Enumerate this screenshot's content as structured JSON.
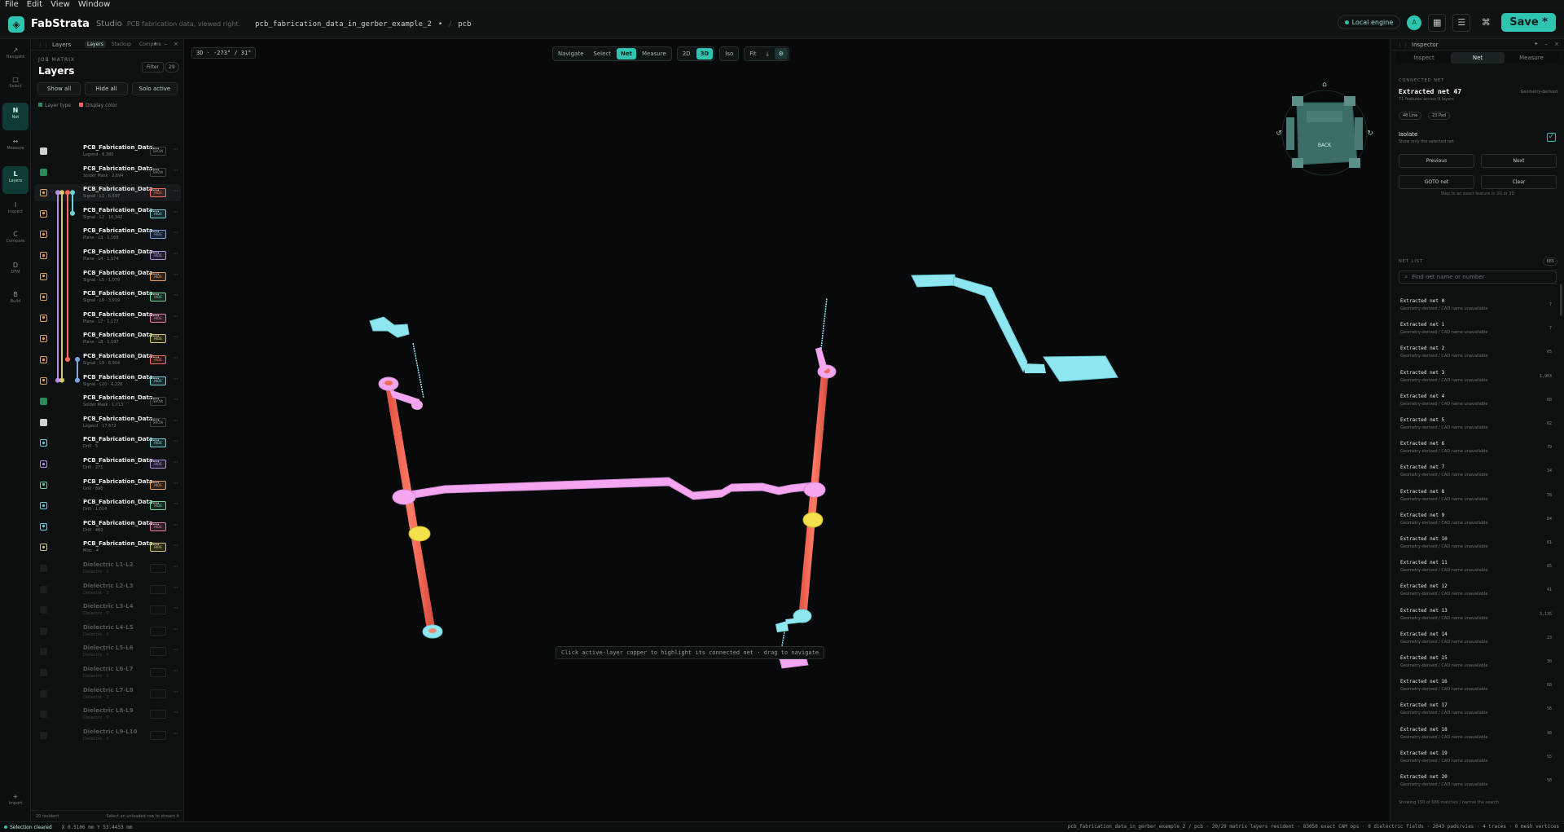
{
  "menu": [
    "File",
    "Edit",
    "View",
    "Window"
  ],
  "header": {
    "app_name": "FabStrata",
    "app_edition": "Studio",
    "app_hint": "PCB fabrication data, viewed right.",
    "project": "pcb_fabrication_data_in_gerber_example_2",
    "project_marker": "•",
    "breadcrumb_sep": "/",
    "breadcrumb_leaf": "pcb",
    "engine": "Local engine",
    "avatar": "A",
    "save": "Save *"
  },
  "rail": [
    {
      "glyph": "↗",
      "label": "Navigate"
    },
    {
      "glyph": "□",
      "label": "Select"
    },
    {
      "glyph": "N",
      "label": "Net",
      "active": true
    },
    {
      "glyph": "↔",
      "label": "Measure"
    },
    {
      "glyph": "L",
      "label": "Layers",
      "active": true
    },
    {
      "glyph": "I",
      "label": "Inspect"
    },
    {
      "glyph": "C",
      "label": "Compare"
    },
    {
      "glyph": "D",
      "label": "DFM"
    },
    {
      "glyph": "B",
      "label": "Build"
    },
    {
      "glyph": "+",
      "label": "Import"
    }
  ],
  "layers_panel": {
    "title": "Layers",
    "tabs": [
      "Layers",
      "Stackup",
      "Compare"
    ],
    "matrix_label": "JOB MATRIX",
    "heading": "Layers",
    "filter": "Filter",
    "count": "29",
    "show_all": "Show all",
    "hide_all": "Hide all",
    "solo_active": "Solo active",
    "legend_type": "Layer type",
    "legend_color": "Display color",
    "footer_left": "20 resident",
    "footer_right": "Select an unloaded row to stream it",
    "rows": [
      {
        "name": "PCB_Fabrication_Data...",
        "sub": "Legend · 8,380",
        "tag": "SHOW",
        "color": "#d0d3d4",
        "style": "solid"
      },
      {
        "name": "PCB_Fabrication_Data...",
        "sub": "Solder Mask · 2,694",
        "tag": "SHOW",
        "color": "#2e8a5a",
        "style": "solid"
      },
      {
        "name": "PCB_Fabrication_Data...",
        "sub": "Signal · L1 · 6,597",
        "tag": "HIDE",
        "color": "#e3a052",
        "style": "ring",
        "tagcolor": "#ff6b5b",
        "active": true
      },
      {
        "name": "PCB_Fabrication_Data...",
        "sub": "Signal · L2 · 10,342",
        "tag": "HIDE",
        "color": "#e3a052",
        "style": "ring",
        "tagcolor": "#6fd3d6"
      },
      {
        "name": "PCB_Fabrication_Data...",
        "sub": "Plane · L3 · 1,168",
        "tag": "HIDE",
        "color": "#e3a052",
        "style": "ring",
        "tagcolor": "#7aa6e6"
      },
      {
        "name": "PCB_Fabrication_Data...",
        "sub": "Plane · L4 · 1,174",
        "tag": "HIDE",
        "color": "#e3a052",
        "style": "ring",
        "tagcolor": "#b58ce6"
      },
      {
        "name": "PCB_Fabrication_Data...",
        "sub": "Signal · L5 · 1,079",
        "tag": "HIDE",
        "color": "#e3a052",
        "style": "ring",
        "tagcolor": "#e6a060"
      },
      {
        "name": "PCB_Fabrication_Data...",
        "sub": "Signal · L6 · 3,919",
        "tag": "HIDE",
        "color": "#e3a052",
        "style": "ring",
        "tagcolor": "#6fd39a"
      },
      {
        "name": "PCB_Fabrication_Data...",
        "sub": "Plane · L7 · 1,177",
        "tag": "HIDE",
        "color": "#e3a052",
        "style": "ring",
        "tagcolor": "#e67aa8"
      },
      {
        "name": "PCB_Fabrication_Data...",
        "sub": "Plane · L8 · 1,197",
        "tag": "HIDE",
        "color": "#e3a052",
        "style": "ring",
        "tagcolor": "#d6c86a"
      },
      {
        "name": "PCB_Fabrication_Data...",
        "sub": "Signal · L9 · 6,904",
        "tag": "HIDE",
        "color": "#e3a052",
        "style": "ring",
        "tagcolor": "#ff6b5b"
      },
      {
        "name": "PCB_Fabrication_Data...",
        "sub": "Signal · L10 · 4,228",
        "tag": "HIDE",
        "color": "#e3a052",
        "style": "ring",
        "tagcolor": "#6fd3d6"
      },
      {
        "name": "PCB_Fabrication_Data...",
        "sub": "Solder Mask · 1,713",
        "tag": "SHOW",
        "color": "#2e8a5a",
        "style": "solid"
      },
      {
        "name": "PCB_Fabrication_Data...",
        "sub": "Legend · 17,672",
        "tag": "SHOW",
        "color": "#d0d3d4",
        "style": "solid"
      },
      {
        "name": "PCB_Fabrication_Data...",
        "sub": "Drill · 5",
        "tag": "HIDE",
        "color": "#5fd0e0",
        "style": "ring",
        "tagcolor": "#6fd3d6"
      },
      {
        "name": "PCB_Fabrication_Data...",
        "sub": "Drill · 271",
        "tag": "HIDE",
        "color": "#b58ce6",
        "style": "ring",
        "tagcolor": "#b58ce6"
      },
      {
        "name": "PCB_Fabrication_Data...",
        "sub": "Drill · 890",
        "tag": "HIDE",
        "color": "#5fd0a0",
        "style": "ring",
        "tagcolor": "#e6a060"
      },
      {
        "name": "PCB_Fabrication_Data...",
        "sub": "Drill · 1,014",
        "tag": "HIDE",
        "color": "#5fd0e0",
        "style": "ring",
        "tagcolor": "#6fd39a"
      },
      {
        "name": "PCB_Fabrication_Data...",
        "sub": "Drill · 460",
        "tag": "HIDE",
        "color": "#5fd0e0",
        "style": "ring",
        "tagcolor": "#e67aa8"
      },
      {
        "name": "PCB_Fabrication_Data...",
        "sub": "Misc · 4",
        "tag": "HIDE",
        "color": "#c9c278",
        "style": "ring",
        "tagcolor": "#d6c86a"
      },
      {
        "name": "Dielectric L1-L2",
        "sub": "Dielectric · 0",
        "tag": "",
        "dim": true
      },
      {
        "name": "Dielectric L2-L3",
        "sub": "Dielectric · 0",
        "tag": "",
        "dim": true
      },
      {
        "name": "Dielectric L3-L4",
        "sub": "Dielectric · 0",
        "tag": "",
        "dim": true
      },
      {
        "name": "Dielectric L4-L5",
        "sub": "Dielectric · 0",
        "tag": "",
        "dim": true
      },
      {
        "name": "Dielectric L5-L6",
        "sub": "Dielectric · 0",
        "tag": "",
        "dim": true
      },
      {
        "name": "Dielectric L6-L7",
        "sub": "Dielectric · 0",
        "tag": "",
        "dim": true
      },
      {
        "name": "Dielectric L7-L8",
        "sub": "Dielectric · 0",
        "tag": "",
        "dim": true
      },
      {
        "name": "Dielectric L8-L9",
        "sub": "Dielectric · 0",
        "tag": "",
        "dim": true
      },
      {
        "name": "Dielectric L9-L10",
        "sub": "Dielectric · 0",
        "tag": "",
        "dim": true
      }
    ]
  },
  "viewport": {
    "camera": "3D · -273° / 31°",
    "toolbar": {
      "modes": [
        "Navigate",
        "Select",
        "Net",
        "Measure"
      ],
      "active_mode": "Net",
      "views": [
        "2D",
        "3D"
      ],
      "active_view": "3D",
      "iso": "Iso",
      "fit": "Fit"
    },
    "hint": "Click active-layer copper to highlight its connected net · drag to navigate",
    "cube_face": "BACK",
    "colors": {
      "trace": "#f4a7f0",
      "drill": "#f26a57",
      "pad": "#8ee7f0",
      "ring": "#f3e04a"
    }
  },
  "inspector": {
    "title": "Inspector",
    "tabs": [
      "Inspect",
      "Net",
      "Measure"
    ],
    "active_tab": "Net",
    "connected_label": "CONNECTED NET",
    "net_title": "Extracted net 47",
    "net_kind": "Geometry-derived",
    "net_sub": "71 features across 9 layers",
    "chips": [
      "48 Line",
      "23 Pad"
    ],
    "isolate": "Isolate",
    "isolate_sub": "Show only the selected net",
    "previous": "Previous",
    "next": "Next",
    "goto": "GOTO net",
    "clear": "Clear",
    "note": "Step to an exact feature in 2D or 3D",
    "netlist_label": "NET LIST",
    "netlist_count": "686",
    "search_placeholder": "Find net name or number",
    "nets": [
      {
        "name": "Extracted net 0",
        "desc": "Geometry-derived / CAD name unavailable",
        "count": "7"
      },
      {
        "name": "Extracted net 1",
        "desc": "Geometry-derived / CAD name unavailable",
        "count": "7"
      },
      {
        "name": "Extracted net 2",
        "desc": "Geometry-derived / CAD name unavailable",
        "count": "65"
      },
      {
        "name": "Extracted net 3",
        "desc": "Geometry-derived / CAD name unavailable",
        "count": "1,903"
      },
      {
        "name": "Extracted net 4",
        "desc": "Geometry-derived / CAD name unavailable",
        "count": "68"
      },
      {
        "name": "Extracted net 5",
        "desc": "Geometry-derived / CAD name unavailable",
        "count": "62"
      },
      {
        "name": "Extracted net 6",
        "desc": "Geometry-derived / CAD name unavailable",
        "count": "79"
      },
      {
        "name": "Extracted net 7",
        "desc": "Geometry-derived / CAD name unavailable",
        "count": "34"
      },
      {
        "name": "Extracted net 8",
        "desc": "Geometry-derived / CAD name unavailable",
        "count": "78"
      },
      {
        "name": "Extracted net 9",
        "desc": "Geometry-derived / CAD name unavailable",
        "count": "84"
      },
      {
        "name": "Extracted net 10",
        "desc": "Geometry-derived / CAD name unavailable",
        "count": "81"
      },
      {
        "name": "Extracted net 11",
        "desc": "Geometry-derived / CAD name unavailable",
        "count": "85"
      },
      {
        "name": "Extracted net 12",
        "desc": "Geometry-derived / CAD name unavailable",
        "count": "41"
      },
      {
        "name": "Extracted net 13",
        "desc": "Geometry-derived / CAD name unavailable",
        "count": "3,135"
      },
      {
        "name": "Extracted net 14",
        "desc": "Geometry-derived / CAD name unavailable",
        "count": "23"
      },
      {
        "name": "Extracted net 15",
        "desc": "Geometry-derived / CAD name unavailable",
        "count": "30"
      },
      {
        "name": "Extracted net 16",
        "desc": "Geometry-derived / CAD name unavailable",
        "count": "68"
      },
      {
        "name": "Extracted net 17",
        "desc": "Geometry-derived / CAD name unavailable",
        "count": "56"
      },
      {
        "name": "Extracted net 18",
        "desc": "Geometry-derived / CAD name unavailable",
        "count": "48"
      },
      {
        "name": "Extracted net 19",
        "desc": "Geometry-derived / CAD name unavailable",
        "count": "55"
      },
      {
        "name": "Extracted net 20",
        "desc": "Geometry-derived / CAD name unavailable",
        "count": "50"
      }
    ],
    "footer": "Showing 150 of 686 matches / narrow the search"
  },
  "status": {
    "selection": "Selection cleared",
    "coords": "X 0.5106 mm Y 53.4433 mm",
    "summary": "pcb_fabrication_data_in_gerber_example_2 / pcb · 20/29 matrix layers resident · 83050 exact CAM ops · 0 dielectric fields · 2643 pads/vias · 4 traces · 0 mesh vertices"
  }
}
